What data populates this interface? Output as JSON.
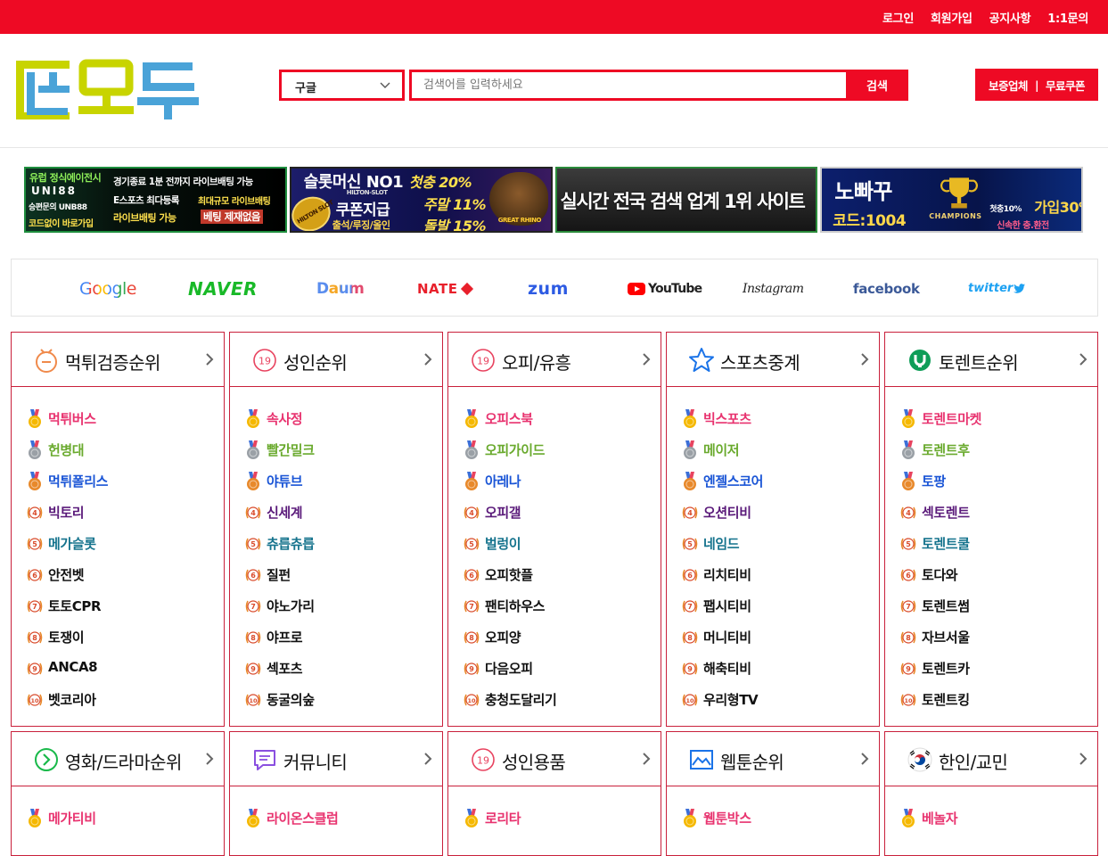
{
  "topbar": {
    "links": [
      "로그인",
      "회원가입",
      "공지사항",
      "1:1문의"
    ]
  },
  "header": {
    "select_value": "구글",
    "search_placeholder": "검색어를 입력하세요",
    "search_button": "검색",
    "guarantee": "보증업체",
    "separator": "|",
    "coupon": "무료쿠폰"
  },
  "banners": [
    {
      "lines": [
        "유럽 정식에이전시",
        "UNI88",
        "승편문의 UNB88",
        "코드없이 바로가입",
        "경기종료 1분 전까지 라이브배팅 가능",
        "E스포츠 최다등록",
        "최대규모 라이브배팅",
        "라이브배팅 가능",
        "베팅 제재없음"
      ]
    },
    {
      "lines": [
        "슬롯머신 NO1",
        "HILTON-SLOT",
        "쿠폰지급",
        "출석/루징/올인",
        "첫충 20%",
        "주말 11%",
        "돌발 15%",
        "HILTON SLOT",
        "GREAT RHINO"
      ]
    },
    {
      "lines": [
        "실시간 전국 검색 업계 1위 사이트"
      ]
    },
    {
      "lines": [
        "노빠꾸",
        "코드:1004",
        "CHAMPIONS",
        "첫충10%",
        "가입30%",
        "신속한 충.환전"
      ]
    }
  ],
  "portals": [
    "Google",
    "NAVER",
    "Daum",
    "NATE",
    "zum",
    "YouTube",
    "Instagram",
    "facebook",
    "twitter"
  ],
  "sections_row1": [
    {
      "title": "먹튀검증순위",
      "icon": "smile-icon",
      "items": [
        "먹튀버스",
        "헌병대",
        "먹튀폴리스",
        "빅토리",
        "메가슬롯",
        "안전벳",
        "토토CPR",
        "토쟁이",
        "ANCA8",
        "벳코리아"
      ]
    },
    {
      "title": "성인순위",
      "icon": "adult-19-icon",
      "items": [
        "속사정",
        "빨간밀크",
        "야튜브",
        "신세계",
        "츄릅츄릅",
        "질펀",
        "야노가리",
        "야프로",
        "섹포츠",
        "동굴의숲"
      ]
    },
    {
      "title": "오피/유흥",
      "icon": "adult-19-icon",
      "items": [
        "오피스북",
        "오피가이드",
        "아레나",
        "오피갤",
        "벌렁이",
        "오피핫플",
        "팬티하우스",
        "오피양",
        "다음오피",
        "충청도달리기"
      ]
    },
    {
      "title": "스포츠중계",
      "icon": "star-icon",
      "items": [
        "빅스포츠",
        "메이저",
        "엔젤스코어",
        "오션티비",
        "네임드",
        "리치티비",
        "팹시티비",
        "머니티비",
        "해축티비",
        "우리형TV"
      ]
    },
    {
      "title": "토렌트순위",
      "icon": "torrent-icon",
      "items": [
        "토렌트마켓",
        "토렌트후",
        "토팡",
        "섹토렌트",
        "토렌트쿨",
        "토다와",
        "토렌트썸",
        "자브서울",
        "토렌트카",
        "토렌트킹"
      ]
    }
  ],
  "sections_row2": [
    {
      "title": "영화/드라마순위",
      "icon": "play-circle-icon",
      "items": [
        "메가티비"
      ]
    },
    {
      "title": "커뮤니티",
      "icon": "chat-icon",
      "items": [
        "라이온스클럽"
      ]
    },
    {
      "title": "성인용품",
      "icon": "adult-19-icon",
      "items": [
        "로리타"
      ]
    },
    {
      "title": "웹툰순위",
      "icon": "image-icon",
      "items": [
        "웹툰박스"
      ]
    },
    {
      "title": "한인/교민",
      "icon": "korea-flag-icon",
      "items": [
        "베놀자"
      ]
    }
  ],
  "rank_badges": [
    "4",
    "5",
    "6",
    "7",
    "8",
    "9",
    "10"
  ],
  "colors": {
    "brand_red": "#ee0a24",
    "box_border": "#c9203b",
    "logo_yellow": "#c8d400",
    "logo_blue": "#4aa3d8"
  }
}
